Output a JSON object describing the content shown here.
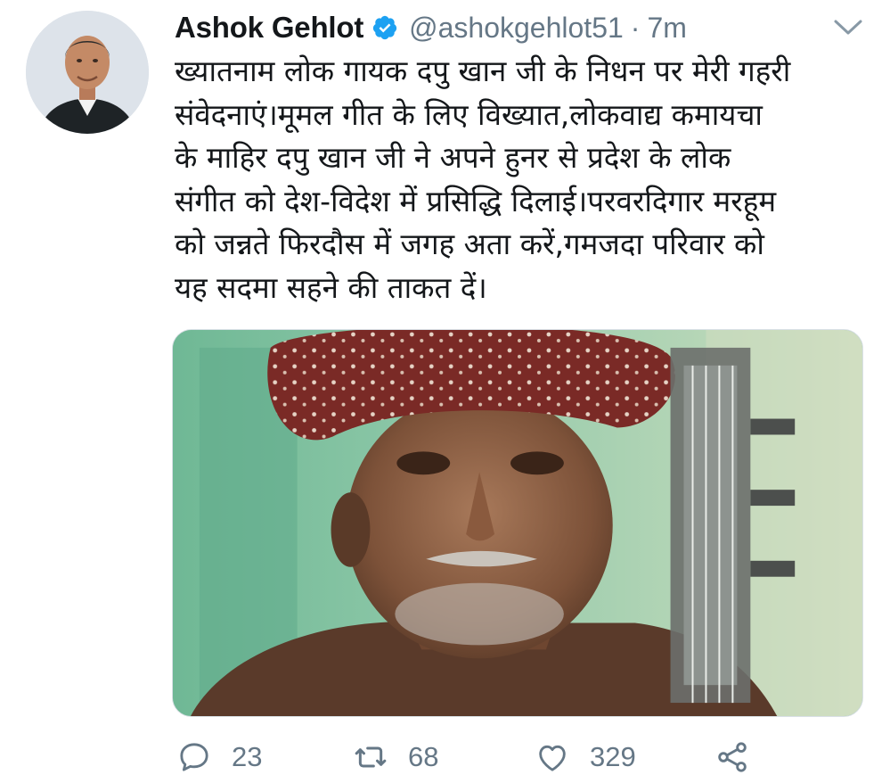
{
  "tweet": {
    "author_name": "Ashok Gehlot",
    "handle": "@ashokgehlot51",
    "separator": "·",
    "time": "7m",
    "verified": true,
    "text": "ख्यातनाम लोक गायक दपु खान जी के निधन पर मेरी गहरी\nसंवेदनाएं।मूमल गीत के लिए विख्यात,लोकवाद्य कमायचा\nके माहिर दपु खान जी ने अपने हुनर से प्रदेश के लोक\nसंगीत को देश-विदेश में प्रसिद्धि दिलाई।परवरदिगार मरहूम\nको जन्नते फिरदौस में जगह अता करें,गमजदा परिवार को\nयह सदमा सहने की ताकत दें।"
  },
  "actions": {
    "replies": "23",
    "retweets": "68",
    "likes": "329"
  },
  "icons": {
    "verified": "verified-badge-icon",
    "caret": "chevron-down-icon",
    "reply": "reply-icon",
    "retweet": "retweet-icon",
    "like": "heart-icon",
    "share": "share-icon"
  },
  "colors": {
    "verified": "#1da1f2",
    "secondary_text": "#657786",
    "primary_text": "#14171a"
  }
}
